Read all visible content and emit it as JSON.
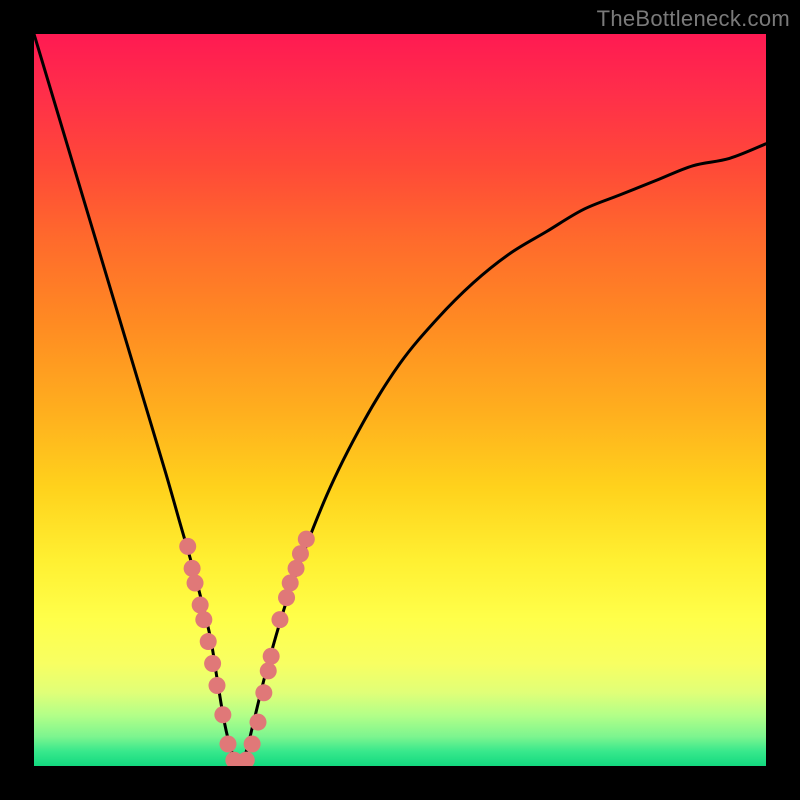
{
  "watermark": "TheBottleneck.com",
  "chart_data": {
    "type": "line",
    "title": "",
    "xlabel": "",
    "ylabel": "",
    "xlim": [
      0,
      100
    ],
    "ylim": [
      0,
      100
    ],
    "series": [
      {
        "name": "bottleneck-curve",
        "x": [
          0,
          3,
          6,
          9,
          12,
          15,
          18,
          20,
          22,
          24,
          25,
          26,
          27,
          28,
          29,
          30,
          32,
          35,
          40,
          45,
          50,
          55,
          60,
          65,
          70,
          75,
          80,
          85,
          90,
          95,
          100
        ],
        "y": [
          100,
          90,
          80,
          70,
          60,
          50,
          40,
          33,
          26,
          18,
          12,
          6,
          2,
          0,
          2,
          6,
          14,
          24,
          37,
          47,
          55,
          61,
          66,
          70,
          73,
          76,
          78,
          80,
          82,
          83,
          85
        ]
      }
    ],
    "markers": {
      "name": "highlight-points",
      "color": "#e07878",
      "points": [
        {
          "x": 21.0,
          "y": 30
        },
        {
          "x": 21.6,
          "y": 27
        },
        {
          "x": 22.0,
          "y": 25
        },
        {
          "x": 22.7,
          "y": 22
        },
        {
          "x": 23.2,
          "y": 20
        },
        {
          "x": 23.8,
          "y": 17
        },
        {
          "x": 24.4,
          "y": 14
        },
        {
          "x": 25.0,
          "y": 11
        },
        {
          "x": 25.8,
          "y": 7
        },
        {
          "x": 26.5,
          "y": 3
        },
        {
          "x": 27.3,
          "y": 0.8
        },
        {
          "x": 28.2,
          "y": 0.5
        },
        {
          "x": 29.0,
          "y": 0.8
        },
        {
          "x": 29.8,
          "y": 3
        },
        {
          "x": 30.6,
          "y": 6
        },
        {
          "x": 31.4,
          "y": 10
        },
        {
          "x": 32.0,
          "y": 13
        },
        {
          "x": 32.4,
          "y": 15
        },
        {
          "x": 33.6,
          "y": 20
        },
        {
          "x": 34.5,
          "y": 23
        },
        {
          "x": 35.0,
          "y": 25
        },
        {
          "x": 35.8,
          "y": 27
        },
        {
          "x": 36.4,
          "y": 29
        },
        {
          "x": 37.2,
          "y": 31
        }
      ]
    }
  }
}
